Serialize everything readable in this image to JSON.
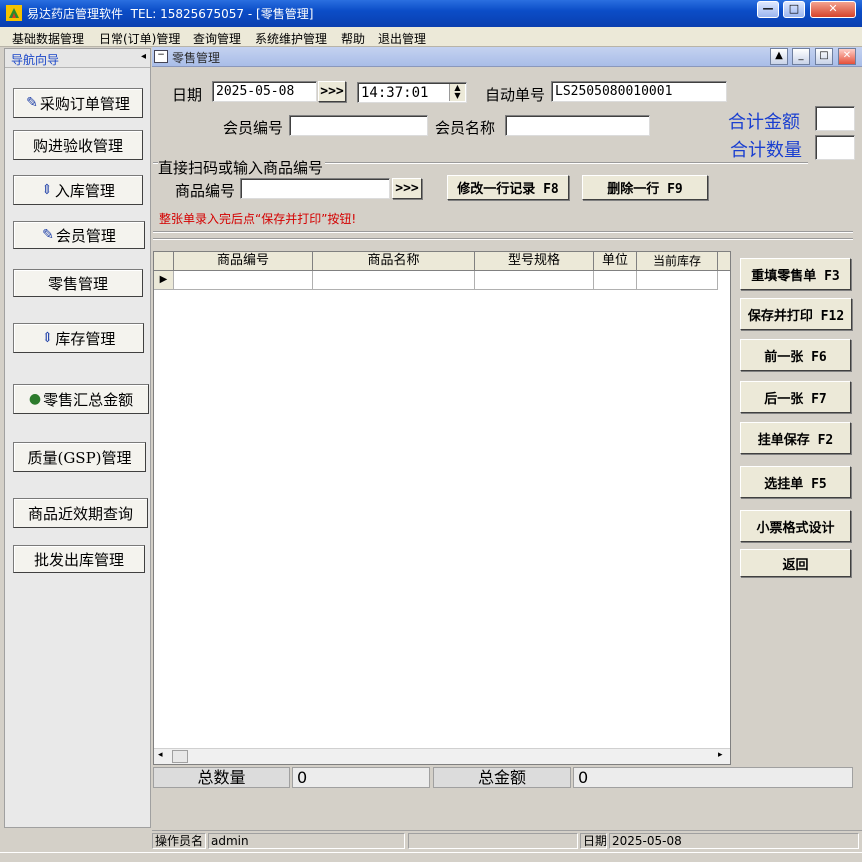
{
  "window": {
    "title": "易达药店管理软件  TEL: 15825675057 - [零售管理]",
    "buttons": {
      "minimize": "—",
      "maximize": "□",
      "close": "✕"
    }
  },
  "menu": [
    "基础数据管理",
    "日常(订单)管理",
    "查询管理",
    "系统维护管理",
    "帮助",
    "退出管理"
  ],
  "nav": {
    "header": "导航向导",
    "collapse": "◂",
    "items": [
      {
        "label": "采购订单管理",
        "icon": "order-icon"
      },
      {
        "label": "购进验收管理",
        "icon": ""
      },
      {
        "label": "入库管理",
        "icon": "inbound-icon"
      },
      {
        "label": "会员管理",
        "icon": "member-icon"
      },
      {
        "label": "零售管理",
        "icon": ""
      },
      {
        "label": "库存管理",
        "icon": "stock-icon"
      },
      {
        "label": "零售汇总金额",
        "icon": "money-bag-icon"
      },
      {
        "label": "质量(GSP)管理",
        "icon": ""
      },
      {
        "label": "商品近效期查询",
        "icon": ""
      },
      {
        "label": "批发出库管理",
        "icon": ""
      }
    ]
  },
  "form": {
    "title": "零售管理",
    "date_label": "日期",
    "date_value": "2025-05-08",
    "date_button": ">>>",
    "time_value": "14:37:01",
    "auto_no_label": "自动单号",
    "auto_no_value": "LS2505080010001",
    "member_no_label": "会员编号",
    "member_no_value": "",
    "member_name_label": "会员名称",
    "member_name_value": "",
    "total_amount_label": "合计金额",
    "total_qty_label": "合计数量",
    "scan_section": "直接扫码或输入商品编号",
    "product_no_label": "商品编号",
    "product_no_value": "",
    "product_button": ">>>",
    "edit_row_button": "修改一行记录 F8",
    "delete_row_button": "删除一行  F9",
    "hint": "整张单录入完后点“保存并打印”按钮!"
  },
  "grid": {
    "columns": [
      "商品编号",
      "商品名称",
      "型号规格",
      "单位",
      "当前库存"
    ],
    "row_indicator": "▶",
    "rows": []
  },
  "actions": [
    "重填零售单 F3",
    "保存并打印 F12",
    "前一张 F6",
    "后一张 F7",
    "挂单保存 F2",
    "选挂单 F5",
    "小票格式设计",
    "返回"
  ],
  "totals": {
    "qty_label": "总数量",
    "qty_value": "0",
    "amount_label": "总金额",
    "amount_value": "0"
  },
  "status": {
    "operator_label": "操作员名",
    "operator_value": "admin",
    "date_label": "日期",
    "date_value": "2025-05-08"
  },
  "colors": {
    "title_bar": "#0b4dc7",
    "nav_header_text": "#1a46c8",
    "total_labels": "#1a3fd0",
    "hint_text": "#d40000"
  }
}
